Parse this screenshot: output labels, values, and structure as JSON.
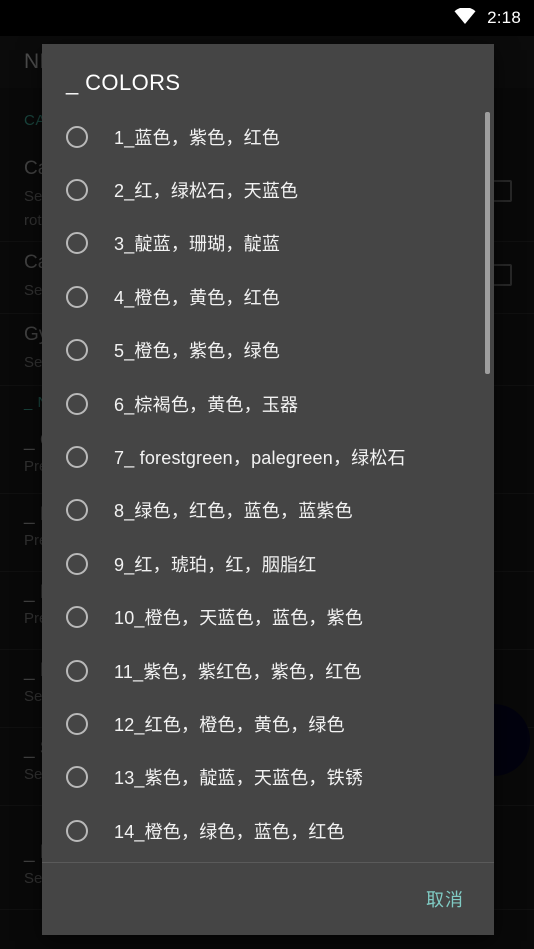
{
  "status_bar": {
    "wifi_icon": "wifi-icon",
    "time": "2:18"
  },
  "background_app": {
    "appbar_title": "NE",
    "section_header": "CA",
    "fab_label": "",
    "rows": [
      {
        "title": "Ca",
        "subtitle": "Set",
        "subtitle2": "rota",
        "checkbox": true
      },
      {
        "title": "Ca",
        "subtitle": "Set",
        "subtitle2": "",
        "checkbox": true
      },
      {
        "title": "Gy",
        "subtitle": "Set",
        "subtitle2": "",
        "checkbox": false
      }
    ],
    "section_header2": "_ N",
    "rows2": [
      {
        "title": "_ C",
        "subtitle": "Pre"
      },
      {
        "title": "_ B",
        "subtitle": "Pre"
      },
      {
        "title": "_ M",
        "subtitle": "Pre"
      },
      {
        "title": "_ B",
        "subtitle": "Set"
      },
      {
        "title": "_ S",
        "subtitle": "Set"
      },
      {
        "title": "_ R",
        "subtitle": "Set"
      }
    ]
  },
  "dialog": {
    "title": "_ COLORS",
    "cancel_label": "取消",
    "scrollbar": {
      "visible": true
    },
    "items": [
      {
        "label": "1_蓝色，紫色，红色",
        "selected": false
      },
      {
        "label": "2_红，绿松石，天蓝色",
        "selected": false
      },
      {
        "label": "3_靛蓝，珊瑚，靛蓝",
        "selected": false
      },
      {
        "label": "4_橙色，黄色，红色",
        "selected": false
      },
      {
        "label": "5_橙色，紫色，绿色",
        "selected": false
      },
      {
        "label": "6_棕褐色，黄色，玉器",
        "selected": false
      },
      {
        "label": "7_ forestgreen，palegreen，绿松石",
        "selected": false
      },
      {
        "label": "8_绿色，红色，蓝色，蓝紫色",
        "selected": false
      },
      {
        "label": "9_红，琥珀，红，胭脂红",
        "selected": false
      },
      {
        "label": "10_橙色，天蓝色，蓝色，紫色",
        "selected": false
      },
      {
        "label": "11_紫色，紫红色，紫色，红色",
        "selected": false
      },
      {
        "label": "12_红色，橙色，黄色，绿色",
        "selected": false
      },
      {
        "label": "13_紫色，靛蓝，天蓝色，铁锈",
        "selected": false
      },
      {
        "label": "14_橙色，绿色，蓝色，红色",
        "selected": false
      }
    ]
  },
  "colors": {
    "dialog_bg": "#454545",
    "screen_bg": "#0d0d0d",
    "accent_teal": "#80cbc4",
    "section_teal": "#2e7d6f",
    "radio_ring": "#b9b9b9",
    "scrollbar": "#9e9e9e"
  }
}
